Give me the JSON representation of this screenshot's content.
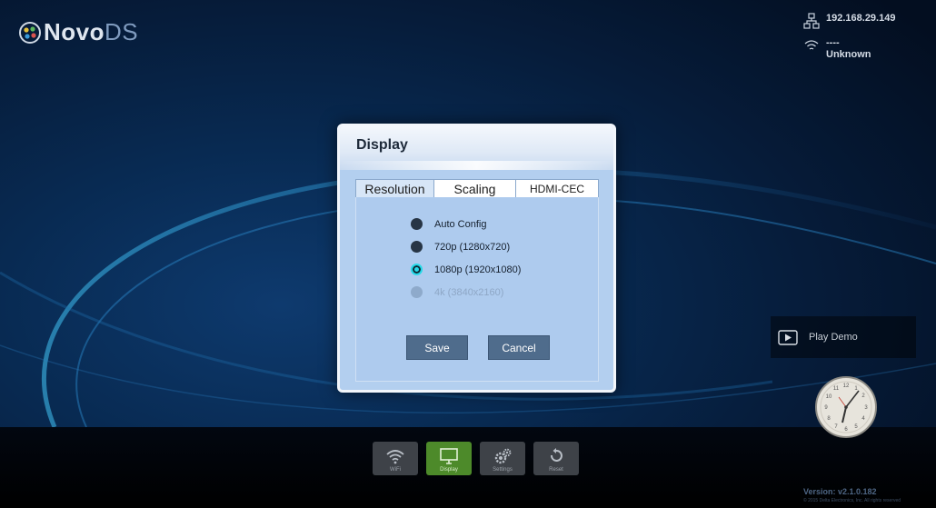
{
  "app": {
    "logo_bold": "Novo",
    "logo_light": "DS"
  },
  "network": {
    "ip": "192.168.29.149",
    "wifi_ssid": "----",
    "wifi_status": "Unknown"
  },
  "dialog": {
    "title": "Display",
    "tabs": [
      {
        "label": "Resolution",
        "active": true
      },
      {
        "label": "Scaling",
        "active": false
      },
      {
        "label": "HDMI-CEC",
        "active": false
      }
    ],
    "options": [
      {
        "label": "Auto Config",
        "selected": false,
        "enabled": true
      },
      {
        "label": "720p (1280x720)",
        "selected": false,
        "enabled": true
      },
      {
        "label": "1080p (1920x1080)",
        "selected": true,
        "enabled": true
      },
      {
        "label": "4k (3840x2160)",
        "selected": false,
        "enabled": false
      }
    ],
    "save_label": "Save",
    "cancel_label": "Cancel"
  },
  "demo": {
    "label": "Play Demo"
  },
  "toolbar": {
    "items": [
      {
        "label": "WiFi",
        "icon": "wifi-icon",
        "active": false
      },
      {
        "label": "Display",
        "icon": "monitor-icon",
        "active": true
      },
      {
        "label": "Settings",
        "icon": "gears-icon",
        "active": false
      },
      {
        "label": "Reset",
        "icon": "reset-icon",
        "active": false
      }
    ]
  },
  "footer": {
    "version": "Version: v2.1.0.182",
    "copyright": "© 2015 Delta Electronics, Inc. All rights reserved"
  },
  "colors": {
    "accent_cyan": "#26d9e8",
    "active_green": "#4d8a2a",
    "dialog_bg": "#b3cfef"
  }
}
